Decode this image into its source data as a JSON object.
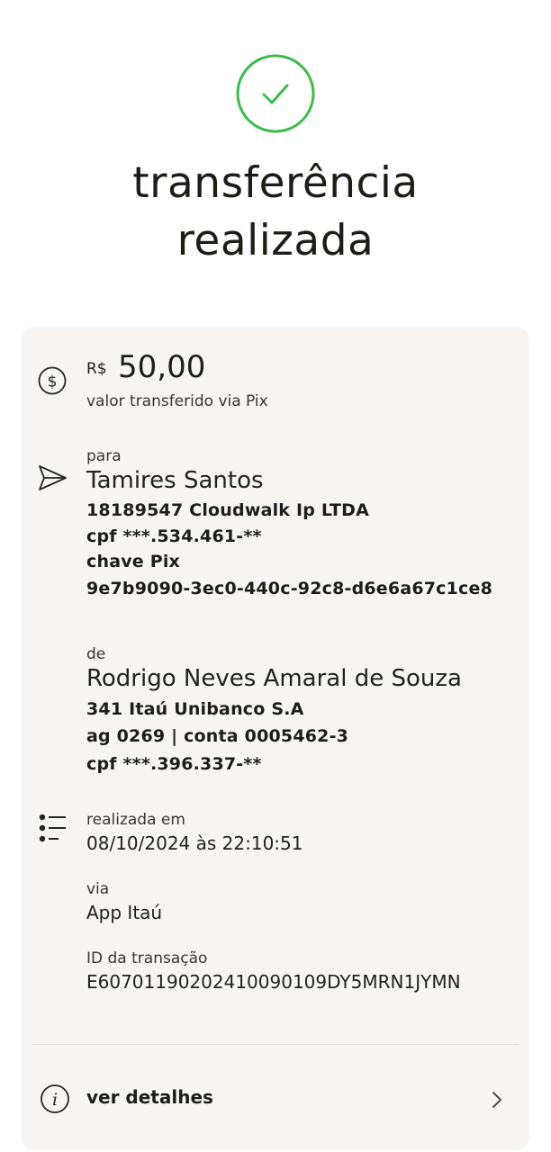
{
  "header": {
    "title_line1": "transferência",
    "title_line2": "realizada",
    "icons": {
      "success": "check-circle-icon"
    },
    "colors": {
      "success": "#3dbb4a"
    }
  },
  "amount": {
    "currency": "R$",
    "value": "50,00",
    "caption": "valor transferido via Pix",
    "icon": "dollar-circle-icon"
  },
  "recipient": {
    "label": "para",
    "name": "Tamires Santos",
    "institution": "18189547 Cloudwalk Ip LTDA",
    "cpf": "cpf ***.534.461-**",
    "pix_key_label": "chave Pix",
    "pix_key": "9e7b9090-3ec0-440c-92c8-d6e6a67c1ce8",
    "icon": "send-icon"
  },
  "sender": {
    "label": "de",
    "name": "Rodrigo Neves Amaral de Souza",
    "bank": "341 Itaú Unibanco S.A",
    "account": "ag 0269 | conta 0005462-3",
    "cpf": "cpf ***.396.337-**"
  },
  "info": {
    "icon": "list-icon",
    "date_label": "realizada em",
    "date_value": "08/10/2024 às 22:10:51",
    "via_label": "via",
    "via_value": "App Itaú",
    "id_label": "ID da transação",
    "id_value": "E60701190202410090109DY5MRN1JYMN"
  },
  "details": {
    "label": "ver detalhes",
    "icon": "info-icon",
    "chevron": "chevron-right-icon"
  }
}
